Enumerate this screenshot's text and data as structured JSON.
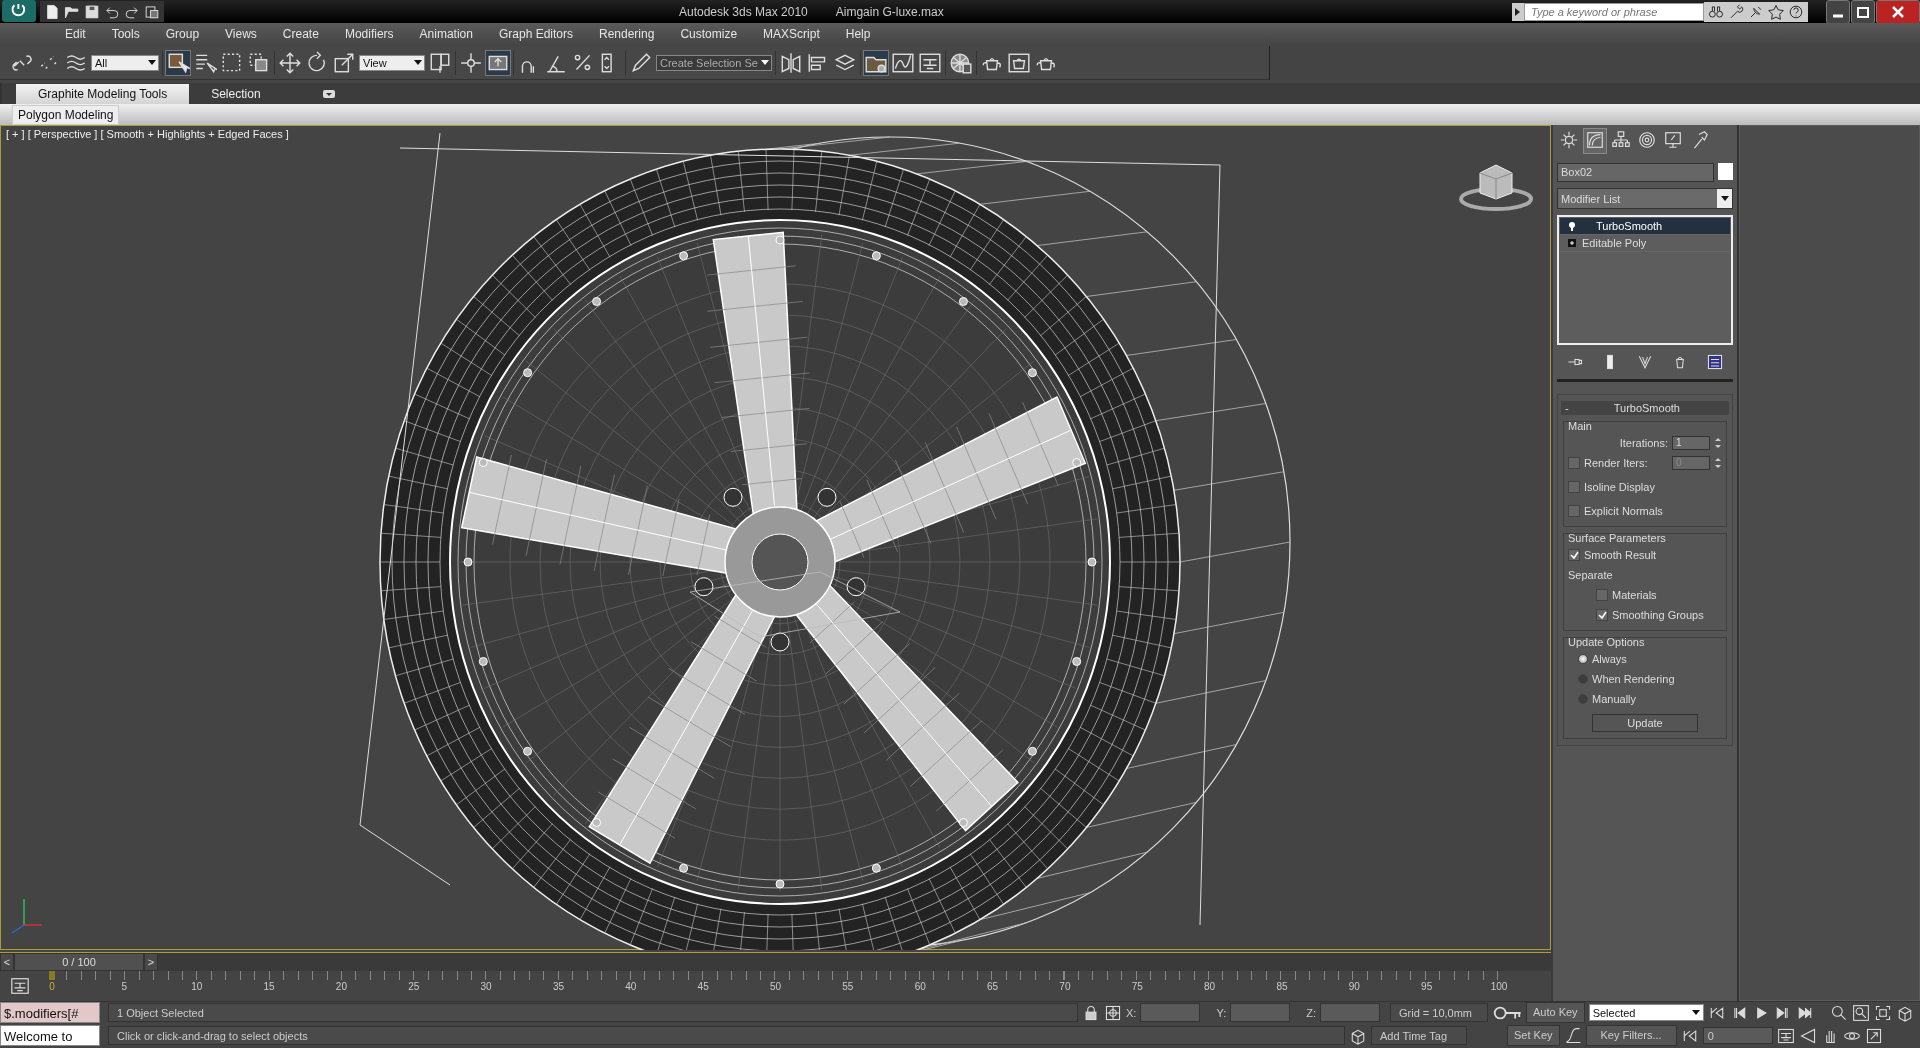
{
  "title_bar": {
    "app_title": "Autodesk 3ds Max  2010",
    "file_name": "Aimgain G-luxe.max",
    "search": {
      "placeholder": "Type a keyword or phrase"
    }
  },
  "menu": [
    "Edit",
    "Tools",
    "Group",
    "Views",
    "Create",
    "Modifiers",
    "Animation",
    "Graph Editors",
    "Rendering",
    "Customize",
    "MAXScript",
    "Help"
  ],
  "toolbar": {
    "selection_filter": "All",
    "reference_coordinate": "View",
    "named_selection": "Create Selection Se"
  },
  "ribbon": {
    "tabs": [
      {
        "label": "Graphite Modeling Tools",
        "selected": true
      },
      {
        "label": "Selection",
        "selected": false
      }
    ],
    "panel": "Polygon Modeling"
  },
  "viewport": {
    "label": "[ + ] [ Perspective ] [ Smooth + Highlights + Edged Faces ]",
    "active": true
  },
  "command_panel": {
    "tabs": [
      {
        "selected": false
      },
      {
        "selected": true
      },
      {
        "selected": false
      },
      {
        "selected": false
      },
      {
        "selected": false
      },
      {
        "selected": false
      }
    ],
    "object_name": "Box02",
    "modifier_list": "Modifier List",
    "stack": [
      {
        "label": "TurboSmooth",
        "selected": true
      },
      {
        "label": "Editable Poly",
        "selected": false
      }
    ],
    "rollout": {
      "collapse": "-",
      "title": "TurboSmooth",
      "main": {
        "title": "Main",
        "items": [
          {
            "kind": "spinner",
            "label": "Iterations:",
            "value": "1"
          },
          {
            "kind": "check_spinner",
            "label": "Render Iters:",
            "value": "0",
            "checked": false
          },
          {
            "kind": "check",
            "label": "Isoline Display",
            "checked": false
          },
          {
            "kind": "check",
            "label": "Explicit Normals",
            "checked": false
          }
        ]
      },
      "surface": {
        "title": "Surface Parameters",
        "smooth_result": {
          "label": "Smooth Result",
          "checked": true
        },
        "separate": "Separate",
        "items": [
          {
            "label": "Materials",
            "checked": false
          },
          {
            "label": "Smoothing Groups",
            "checked": true
          }
        ]
      },
      "update": {
        "title": "Update Options",
        "options": [
          {
            "label": "Always",
            "selected": true
          },
          {
            "label": "When Rendering",
            "selected": false
          },
          {
            "label": "Manually",
            "selected": false
          }
        ],
        "button": "Update"
      }
    }
  },
  "time_slider": {
    "prev": "<",
    "position": "0 / 100",
    "next": ">"
  },
  "track": {
    "ticks": [
      "0",
      "5",
      "10",
      "15",
      "20",
      "25",
      "30",
      "35",
      "40",
      "45",
      "50",
      "55",
      "60",
      "65",
      "70",
      "75",
      "80",
      "85",
      "90",
      "95",
      "100"
    ]
  },
  "status_bar": {
    "maxscript": "$.modifiers[#",
    "listener": "Welcome to",
    "selection": "1 Object Selected",
    "prompt": "Click or click-and-drag to select objects",
    "x_label": "X:",
    "y_label": "Y:",
    "z_label": "Z:",
    "grid": "Grid = 10,0mm",
    "add_time_tag": "Add Time Tag",
    "auto_key": "Auto Key",
    "set_key": "Set Key",
    "key_mode": "Selected",
    "key_filters": "Key Filters...",
    "frame": "0"
  }
}
